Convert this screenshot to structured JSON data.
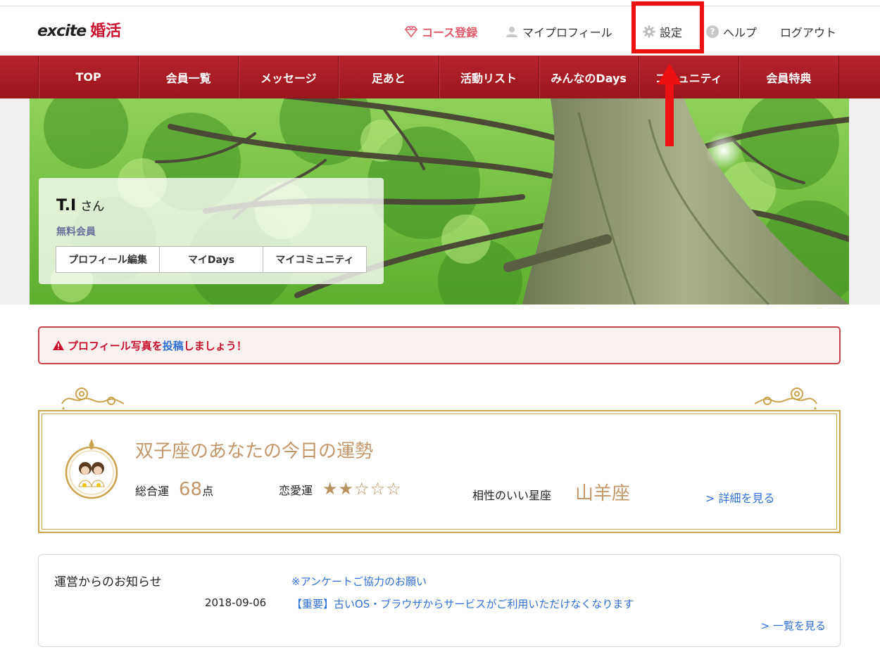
{
  "header": {
    "logo_excite": "excite",
    "logo_konkatsu": "婚活",
    "nav": {
      "course": "コース登録",
      "profile": "マイプロフィール",
      "settings": "設定",
      "help": "ヘルプ",
      "logout": "ログアウト"
    }
  },
  "menu": [
    "TOP",
    "会員一覧",
    "メッセージ",
    "足あと",
    "活動リスト",
    "みんなのDays",
    "コミュニティ",
    "会員特典"
  ],
  "profile": {
    "name": "T.I",
    "honorific": "さん",
    "status": "無料会員",
    "buttons": [
      "プロフィール編集",
      "マイDays",
      "マイコミュニティ"
    ]
  },
  "alert": {
    "before": "プロフィール写真を",
    "link": "投稿",
    "after": "しましょう！"
  },
  "fortune": {
    "title": "双子座のあなたの今日の運勢",
    "overall_label": "総合運",
    "overall_score": "68",
    "overall_unit": "点",
    "love_label": "恋愛運",
    "love_stars_filled": 2,
    "love_stars_total": 5,
    "compat_label": "相性のいい星座",
    "compat_sign": "山羊座",
    "detail_link": "> 詳細を見る"
  },
  "notices": {
    "title": "運営からのお知らせ",
    "items": [
      {
        "date": "",
        "text": "※アンケートご協力のお願い"
      },
      {
        "date": "2018-09-06",
        "text": "【重要】古いOS・ブラウザからサービスがご利用いただけなくなります"
      }
    ],
    "more": "> 一覧を見る"
  },
  "colors": {
    "brand_red": "#c8102e",
    "menu_red": "#a81a22",
    "gold": "#c2976b",
    "link_blue": "#2f6fd6",
    "highlight": "#ee1111"
  }
}
